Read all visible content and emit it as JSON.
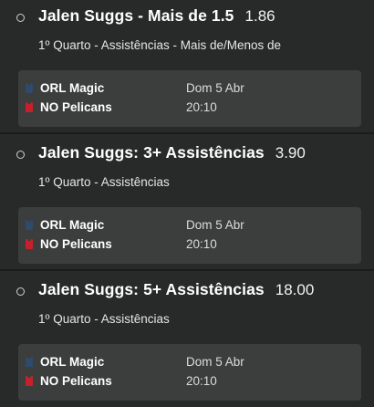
{
  "bets": [
    {
      "selection": "Jalen Suggs - Mais de 1.5",
      "odds": "1.86",
      "market": "1º Quarto - Assistências - Mais de/Menos de",
      "event": {
        "home_team": "ORL Magic",
        "away_team": "NO Pelicans",
        "date": "Dom 5 Abr",
        "time": "20:10"
      }
    },
    {
      "selection": "Jalen Suggs: 3+ Assistências",
      "odds": "3.90",
      "market": "1º Quarto - Assistências",
      "event": {
        "home_team": "ORL Magic",
        "away_team": "NO Pelicans",
        "date": "Dom 5 Abr",
        "time": "20:10"
      }
    },
    {
      "selection": "Jalen Suggs: 5+ Assistências",
      "odds": "18.00",
      "market": "1º Quarto - Assistências",
      "event": {
        "home_team": "ORL Magic",
        "away_team": "NO Pelicans",
        "date": "Dom 5 Abr",
        "time": "20:10"
      }
    }
  ],
  "icons": {
    "radio": "radio-unselected-icon",
    "home_jersey": "jersey-icon",
    "away_jersey": "jersey-icon"
  },
  "colors": {
    "background": "#272a28",
    "event_box": "#3b3e3c",
    "orl_jersey": "#2f4a6b",
    "nop_jersey": "#c8202a"
  }
}
